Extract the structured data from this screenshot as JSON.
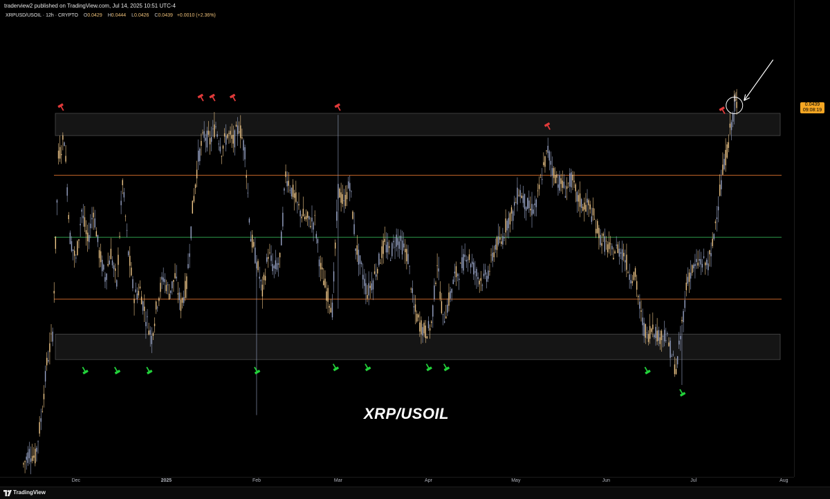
{
  "header": {
    "caption": "traderview2 published on TradingView.com, Jul 14, 2025 10:51 UTC-4",
    "symbol": "XRPUSD/USOIL · 12h · CRYPTO",
    "open_label": "O",
    "open": "0.0429",
    "high_label": "H",
    "high": "0.0444",
    "low_label": "L",
    "low": "0.0426",
    "close_label": "C",
    "close": "0.0439",
    "change": "+0.0010 (+2.36%)"
  },
  "price_badge": {
    "price": "0.0439",
    "countdown": "09:08:19"
  },
  "watermark": "XRP/USOIL",
  "footer": {
    "brand": "TradingView"
  },
  "colors": {
    "candle": "#f2c98a",
    "candle_alt": "#9aa6c9",
    "resistance_line": "#c8672a",
    "support_line": "#c8672a",
    "mid_line": "#2e9a4a",
    "zone_fill": "#151515",
    "sell_marker": "#e03a3a",
    "buy_marker": "#22d13a",
    "badge": "#f5a623"
  },
  "chart_data": {
    "type": "candlestick",
    "title": "",
    "symbol": "XRPUSD/USOIL",
    "interval": "12h",
    "ylim": [
      0.0205,
      0.05
    ],
    "y_ticks": [
      "0.0500",
      "0.0490",
      "0.0480",
      "0.0470",
      "0.0460",
      "0.0450",
      "0.0440",
      "0.0430",
      "0.0420",
      "0.0410",
      "0.0400",
      "0.0390",
      "0.0380",
      "0.0370",
      "0.0360",
      "0.0350",
      "0.0340",
      "0.0330",
      "0.0320",
      "0.0310",
      "0.0300",
      "0.0290",
      "0.0280",
      "0.0270",
      "0.0260",
      "0.0250",
      "0.0240",
      "0.0230",
      "0.0220",
      "0.0210"
    ],
    "x_ticks": [
      {
        "label": "Dec",
        "date": "2024-12-01"
      },
      {
        "label": "2025",
        "date": "2025-01-01",
        "bold": true
      },
      {
        "label": "Feb",
        "date": "2025-02-01"
      },
      {
        "label": "Mar",
        "date": "2025-03-01"
      },
      {
        "label": "Apr",
        "date": "2025-04-01"
      },
      {
        "label": "May",
        "date": "2025-05-01"
      },
      {
        "label": "Jun",
        "date": "2025-06-01"
      },
      {
        "label": "Jul",
        "date": "2025-07-01"
      },
      {
        "label": "Aug",
        "date": "2025-08-01"
      }
    ],
    "x_range": [
      "2024-11-13",
      "2025-08-04"
    ],
    "zones": [
      {
        "name": "resistance",
        "from": 0.0419,
        "to": 0.0433
      },
      {
        "name": "support",
        "from": 0.0278,
        "to": 0.0294
      }
    ],
    "hlines": [
      {
        "name": "upper",
        "value": 0.0394,
        "color": "#c8672a"
      },
      {
        "name": "middle",
        "value": 0.0355,
        "color": "#2e9a4a"
      },
      {
        "name": "lower",
        "value": 0.0316,
        "color": "#c8672a"
      }
    ],
    "sell_markers": [
      {
        "date": "2024-11-26",
        "price": 0.0437
      },
      {
        "date": "2025-01-13",
        "price": 0.0443
      },
      {
        "date": "2025-01-17",
        "price": 0.0443
      },
      {
        "date": "2025-01-24",
        "price": 0.0443
      },
      {
        "date": "2025-03-01",
        "price": 0.0437
      },
      {
        "date": "2025-05-12",
        "price": 0.0425
      },
      {
        "date": "2025-07-11",
        "price": 0.0435
      }
    ],
    "buy_markers": [
      {
        "date": "2024-12-04",
        "price": 0.0271
      },
      {
        "date": "2024-12-15",
        "price": 0.0271
      },
      {
        "date": "2024-12-26",
        "price": 0.0271
      },
      {
        "date": "2025-02-01",
        "price": 0.0271
      },
      {
        "date": "2025-02-28",
        "price": 0.0273
      },
      {
        "date": "2025-03-11",
        "price": 0.0273
      },
      {
        "date": "2025-04-01",
        "price": 0.0273
      },
      {
        "date": "2025-04-07",
        "price": 0.0273
      },
      {
        "date": "2025-06-15",
        "price": 0.0271
      },
      {
        "date": "2025-06-27",
        "price": 0.0257
      }
    ],
    "highlight": {
      "date": "2025-07-15",
      "price": 0.0438,
      "note": "circle with arrow pointing to latest high"
    },
    "series": [
      {
        "type": "ohlc-approx",
        "points": [
          [
            "2024-11-13",
            0.0212
          ],
          [
            "2024-11-15",
            0.022
          ],
          [
            "2024-11-17",
            0.0216
          ],
          [
            "2024-11-19",
            0.024
          ],
          [
            "2024-11-21",
            0.0275
          ],
          [
            "2024-11-23",
            0.0295
          ],
          [
            "2024-11-25",
            0.0405
          ],
          [
            "2024-11-27",
            0.0418
          ],
          [
            "2024-11-29",
            0.0355
          ],
          [
            "2024-12-01",
            0.034
          ],
          [
            "2024-12-03",
            0.0372
          ],
          [
            "2024-12-05",
            0.0352
          ],
          [
            "2024-12-07",
            0.0372
          ],
          [
            "2024-12-09",
            0.0345
          ],
          [
            "2024-12-11",
            0.033
          ],
          [
            "2024-12-13",
            0.0345
          ],
          [
            "2024-12-15",
            0.0325
          ],
          [
            "2024-12-17",
            0.039
          ],
          [
            "2024-12-19",
            0.0345
          ],
          [
            "2024-12-21",
            0.0318
          ],
          [
            "2024-12-23",
            0.0322
          ],
          [
            "2024-12-25",
            0.0305
          ],
          [
            "2024-12-27",
            0.0292
          ],
          [
            "2024-12-29",
            0.0315
          ],
          [
            "2024-12-31",
            0.033
          ],
          [
            "2025-01-02",
            0.032
          ],
          [
            "2025-01-04",
            0.033
          ],
          [
            "2025-01-06",
            0.0312
          ],
          [
            "2025-01-08",
            0.0325
          ],
          [
            "2025-01-10",
            0.0372
          ],
          [
            "2025-01-12",
            0.0405
          ],
          [
            "2025-01-14",
            0.042
          ],
          [
            "2025-01-16",
            0.0415
          ],
          [
            "2025-01-18",
            0.0425
          ],
          [
            "2025-01-20",
            0.041
          ],
          [
            "2025-01-22",
            0.042
          ],
          [
            "2025-01-24",
            0.0415
          ],
          [
            "2025-01-26",
            0.0425
          ],
          [
            "2025-01-28",
            0.041
          ],
          [
            "2025-01-30",
            0.0355
          ],
          [
            "2025-02-01",
            0.034
          ],
          [
            "2025-02-03",
            0.032
          ],
          [
            "2025-02-05",
            0.0345
          ],
          [
            "2025-02-07",
            0.0335
          ],
          [
            "2025-02-09",
            0.034
          ],
          [
            "2025-02-11",
            0.0395
          ],
          [
            "2025-02-13",
            0.0385
          ],
          [
            "2025-02-15",
            0.0375
          ],
          [
            "2025-02-17",
            0.0368
          ],
          [
            "2025-02-19",
            0.0365
          ],
          [
            "2025-02-21",
            0.0365
          ],
          [
            "2025-02-23",
            0.0335
          ],
          [
            "2025-02-25",
            0.032
          ],
          [
            "2025-02-27",
            0.031
          ],
          [
            "2025-03-01",
            0.0385
          ],
          [
            "2025-03-03",
            0.0375
          ],
          [
            "2025-03-05",
            0.039
          ],
          [
            "2025-03-07",
            0.035
          ],
          [
            "2025-03-09",
            0.0335
          ],
          [
            "2025-03-11",
            0.032
          ],
          [
            "2025-03-13",
            0.0328
          ],
          [
            "2025-03-15",
            0.034
          ],
          [
            "2025-03-17",
            0.035
          ],
          [
            "2025-03-19",
            0.0345
          ],
          [
            "2025-03-21",
            0.0355
          ],
          [
            "2025-03-23",
            0.035
          ],
          [
            "2025-03-25",
            0.0342
          ],
          [
            "2025-03-27",
            0.031
          ],
          [
            "2025-03-29",
            0.03
          ],
          [
            "2025-03-31",
            0.0295
          ],
          [
            "2025-04-02",
            0.03
          ],
          [
            "2025-04-04",
            0.034
          ],
          [
            "2025-04-06",
            0.0302
          ],
          [
            "2025-04-08",
            0.0315
          ],
          [
            "2025-04-10",
            0.033
          ],
          [
            "2025-04-12",
            0.0335
          ],
          [
            "2025-04-14",
            0.0345
          ],
          [
            "2025-04-16",
            0.0338
          ],
          [
            "2025-04-18",
            0.033
          ],
          [
            "2025-04-20",
            0.0328
          ],
          [
            "2025-04-22",
            0.0335
          ],
          [
            "2025-04-24",
            0.035
          ],
          [
            "2025-04-26",
            0.0352
          ],
          [
            "2025-04-28",
            0.0365
          ],
          [
            "2025-04-30",
            0.037
          ],
          [
            "2025-05-02",
            0.0385
          ],
          [
            "2025-05-04",
            0.0378
          ],
          [
            "2025-05-06",
            0.0372
          ],
          [
            "2025-05-08",
            0.0375
          ],
          [
            "2025-05-10",
            0.0395
          ],
          [
            "2025-05-12",
            0.041
          ],
          [
            "2025-05-14",
            0.0395
          ],
          [
            "2025-05-16",
            0.039
          ],
          [
            "2025-05-18",
            0.0385
          ],
          [
            "2025-05-20",
            0.0392
          ],
          [
            "2025-05-22",
            0.038
          ],
          [
            "2025-05-24",
            0.0375
          ],
          [
            "2025-05-26",
            0.0375
          ],
          [
            "2025-05-28",
            0.0365
          ],
          [
            "2025-05-30",
            0.0355
          ],
          [
            "2025-06-01",
            0.035
          ],
          [
            "2025-06-03",
            0.0345
          ],
          [
            "2025-06-05",
            0.0348
          ],
          [
            "2025-06-07",
            0.0345
          ],
          [
            "2025-06-09",
            0.0332
          ],
          [
            "2025-06-11",
            0.033
          ],
          [
            "2025-06-13",
            0.0305
          ],
          [
            "2025-06-15",
            0.0292
          ],
          [
            "2025-06-17",
            0.03
          ],
          [
            "2025-06-19",
            0.0292
          ],
          [
            "2025-06-21",
            0.0295
          ],
          [
            "2025-06-23",
            0.0285
          ],
          [
            "2025-06-25",
            0.027
          ],
          [
            "2025-06-27",
            0.03
          ],
          [
            "2025-06-29",
            0.033
          ],
          [
            "2025-07-01",
            0.0335
          ],
          [
            "2025-07-03",
            0.034
          ],
          [
            "2025-07-05",
            0.0338
          ],
          [
            "2025-07-07",
            0.0342
          ],
          [
            "2025-07-09",
            0.0372
          ],
          [
            "2025-07-11",
            0.0395
          ],
          [
            "2025-07-13",
            0.0415
          ],
          [
            "2025-07-15",
            0.0439
          ]
        ]
      }
    ]
  }
}
